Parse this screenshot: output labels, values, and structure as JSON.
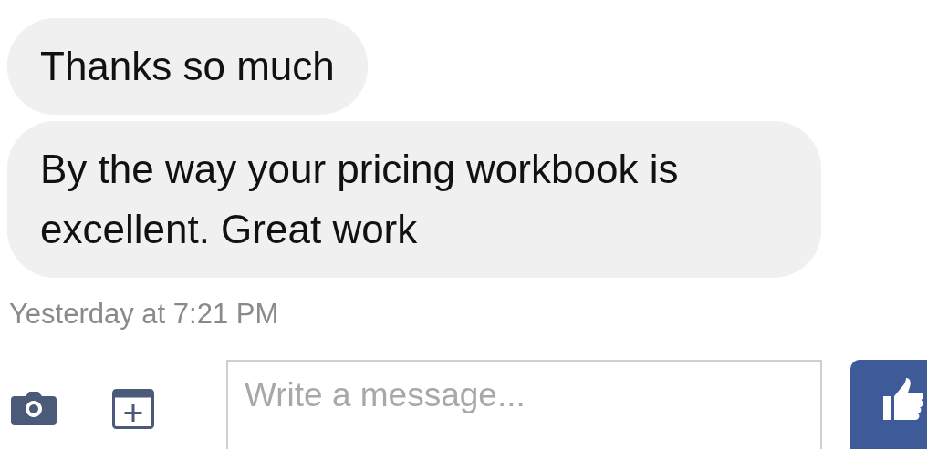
{
  "messages": [
    {
      "text": "Thanks so much"
    },
    {
      "text": "By the way your pricing workbook is excellent. Great work"
    }
  ],
  "timestamp": "Yesterday at 7:21 PM",
  "composer": {
    "placeholder": "Write a message..."
  }
}
